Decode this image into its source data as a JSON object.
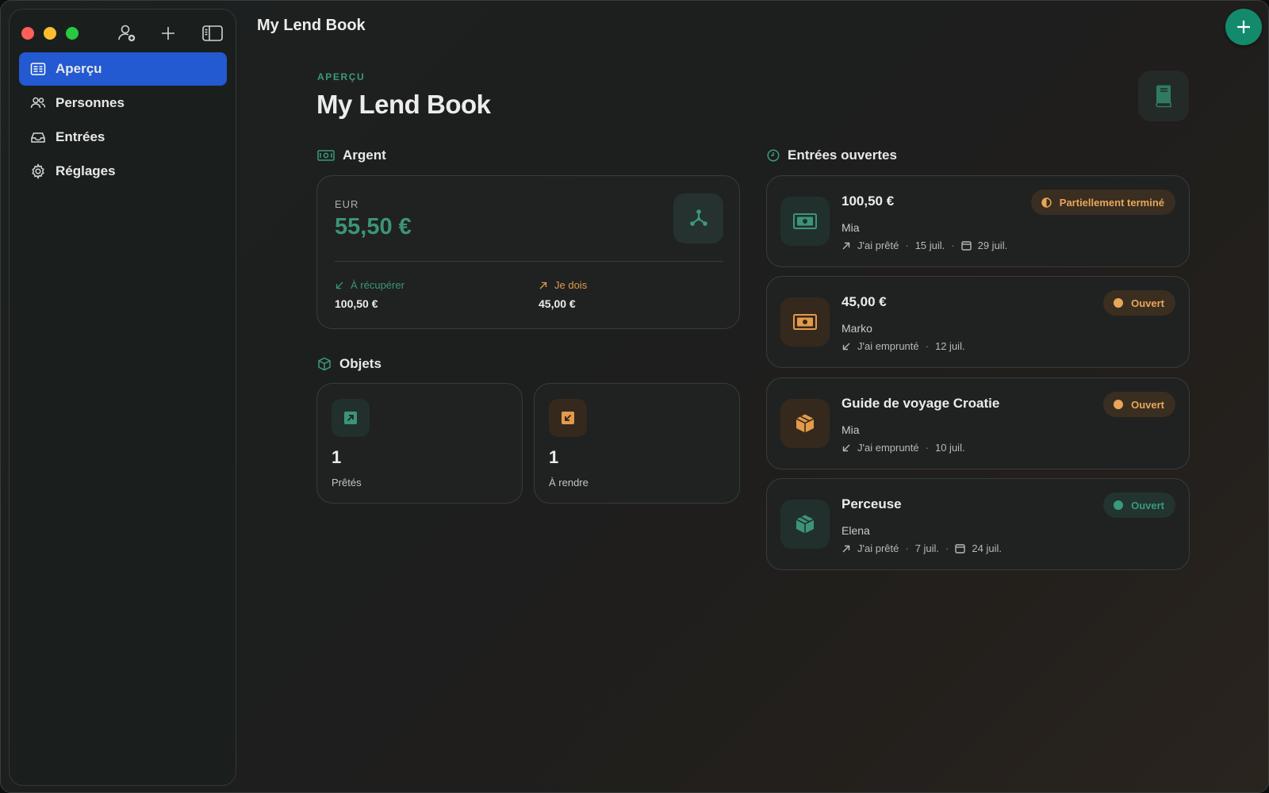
{
  "window": {
    "title": "My Lend Book"
  },
  "sidebar": {
    "tools": [
      "add-person-icon",
      "plus-icon",
      "sidebar-toggle-icon"
    ],
    "items": [
      {
        "label": "Aperçu",
        "icon": "overview-icon",
        "active": true
      },
      {
        "label": "Personnes",
        "icon": "people-icon",
        "active": false
      },
      {
        "label": "Entrées",
        "icon": "tray-icon",
        "active": false
      },
      {
        "label": "Réglages",
        "icon": "gear-icon",
        "active": false
      }
    ]
  },
  "header": {
    "eyebrow": "APERÇU",
    "title": "My Lend Book"
  },
  "money": {
    "section_title": "Argent",
    "currency": "EUR",
    "balance": "55,50 €",
    "to_recover_label": "À récupérer",
    "to_recover_value": "100,50 €",
    "i_owe_label": "Je dois",
    "i_owe_value": "45,00 €"
  },
  "objects": {
    "section_title": "Objets",
    "lent_count": "1",
    "lent_label": "Prêtés",
    "to_return_count": "1",
    "to_return_label": "À rendre"
  },
  "open_entries": {
    "section_title": "Entrées ouvertes",
    "items": [
      {
        "title": "100,50 €",
        "person": "Mia",
        "direction": "J'ai prêté",
        "date": "15 juil.",
        "due": "29 juil.",
        "status": "Partiellement terminé",
        "status_color": "#e9a65a",
        "kind": "money",
        "accent": "#3c9a78"
      },
      {
        "title": "45,00 €",
        "person": "Marko",
        "direction": "J'ai emprunté",
        "date": "12 juil.",
        "status": "Ouvert",
        "status_color": "#e9a65a",
        "kind": "money",
        "accent": "#e39a4a"
      },
      {
        "title": "Guide de voyage Croatie",
        "person": "Mia",
        "direction": "J'ai emprunté",
        "date": "10 juil.",
        "status": "Ouvert",
        "status_color": "#e9a65a",
        "kind": "object",
        "accent": "#e39a4a"
      },
      {
        "title": "Perceuse",
        "person": "Elena",
        "direction": "J'ai prêté",
        "date": "7 juil.",
        "due": "24 juil.",
        "status": "Ouvert",
        "status_color": "#3a9a7a",
        "kind": "object",
        "accent": "#3c9a78"
      }
    ]
  },
  "colors": {
    "accent_blue": "#2359d1",
    "green": "#3c9478",
    "orange": "#e39a4a",
    "fab": "#138a6c"
  }
}
